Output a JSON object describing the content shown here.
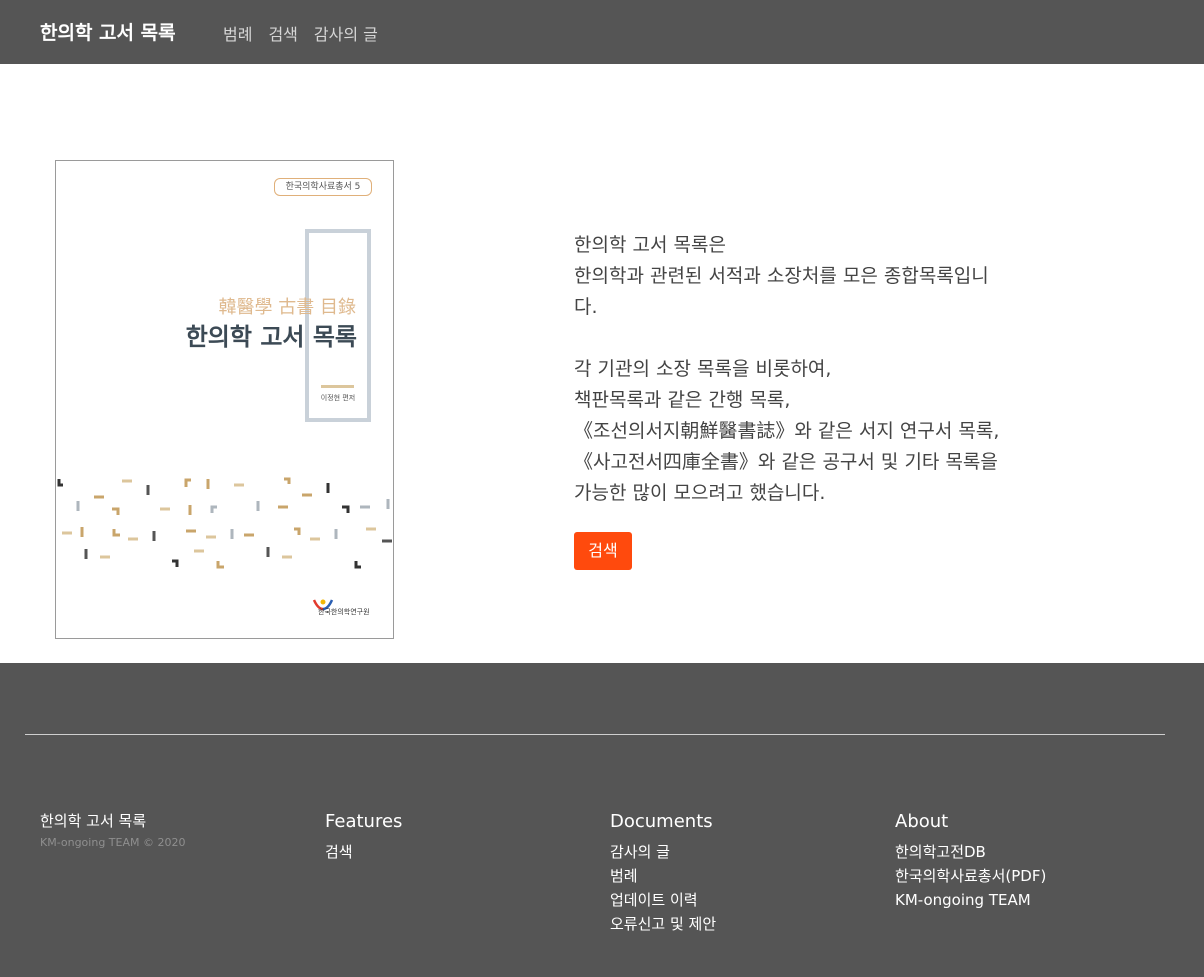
{
  "navbar": {
    "brand": "한의학 고서 목록",
    "links": [
      "범례",
      "검색",
      "감사의 글"
    ]
  },
  "cover": {
    "series_badge": "한국의학사료총서 5",
    "hanja_title": "韓醫學 古書 目錄",
    "title": "한의학 고서 목록",
    "author": "이정현 편저",
    "publisher": "한국한의학연구원"
  },
  "hero": {
    "paragraph1": [
      "한의학 고서 목록은",
      "한의학과 관련된 서적과 소장처를 모은 종합목록입니",
      "다."
    ],
    "paragraph2": [
      "각 기관의 소장 목록을 비롯하여,",
      "책판목록과 같은 간행 목록,",
      "《조선의서지朝鮮醫書誌》와 같은 서지 연구서 목록,",
      "《사고전서四庫全書》와 같은 공구서 및 기타 목록을",
      "가능한 많이 모으려고 했습니다."
    ],
    "search_button": "검색",
    "colors": {
      "button": "#ff4a0d"
    }
  },
  "footer": {
    "brand": "한의학 고서 목록",
    "copyright": "KM-ongoing TEAM © 2020",
    "columns": [
      {
        "heading": "Features",
        "links": [
          "검색"
        ]
      },
      {
        "heading": "Documents",
        "links": [
          "감사의 글",
          "범례",
          "업데이트 이력",
          "오류신고 및 제안"
        ]
      },
      {
        "heading": "About",
        "links": [
          "한의학고전DB",
          "한국의학사료총서(PDF)",
          "KM-ongoing TEAM"
        ]
      }
    ],
    "colors": {
      "background": "#555555"
    }
  }
}
